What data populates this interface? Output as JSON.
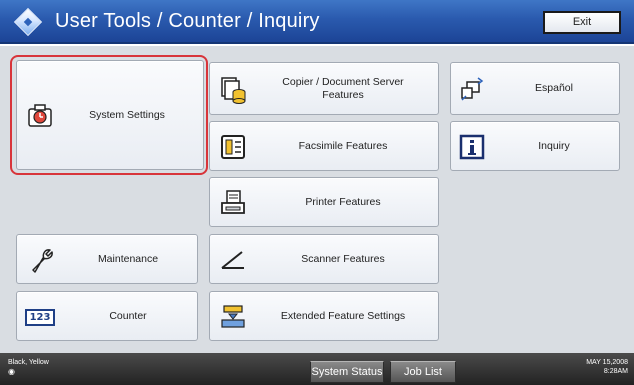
{
  "header": {
    "title": "User Tools / Counter / Inquiry",
    "exit_label": "Exit"
  },
  "menu": {
    "system_settings": "System Settings",
    "copier_line1": "Copier / Document Server",
    "copier_line2": "Features",
    "facsimile": "Facsimile Features",
    "printer": "Printer Features",
    "scanner": "Scanner Features",
    "extended": "Extended Feature Settings",
    "maintenance": "Maintenance",
    "counter": "Counter",
    "espanol": "Español",
    "inquiry": "Inquiry"
  },
  "icons": {
    "counter_badge": "123"
  },
  "footer": {
    "toner_status": "Black, Yellow",
    "system_status": "System Status",
    "job_list": "Job List",
    "date": "MAY  15,2008",
    "time": "8:28AM"
  },
  "colors": {
    "header_blue": "#2a5aae",
    "selection_red": "#d8343a"
  }
}
